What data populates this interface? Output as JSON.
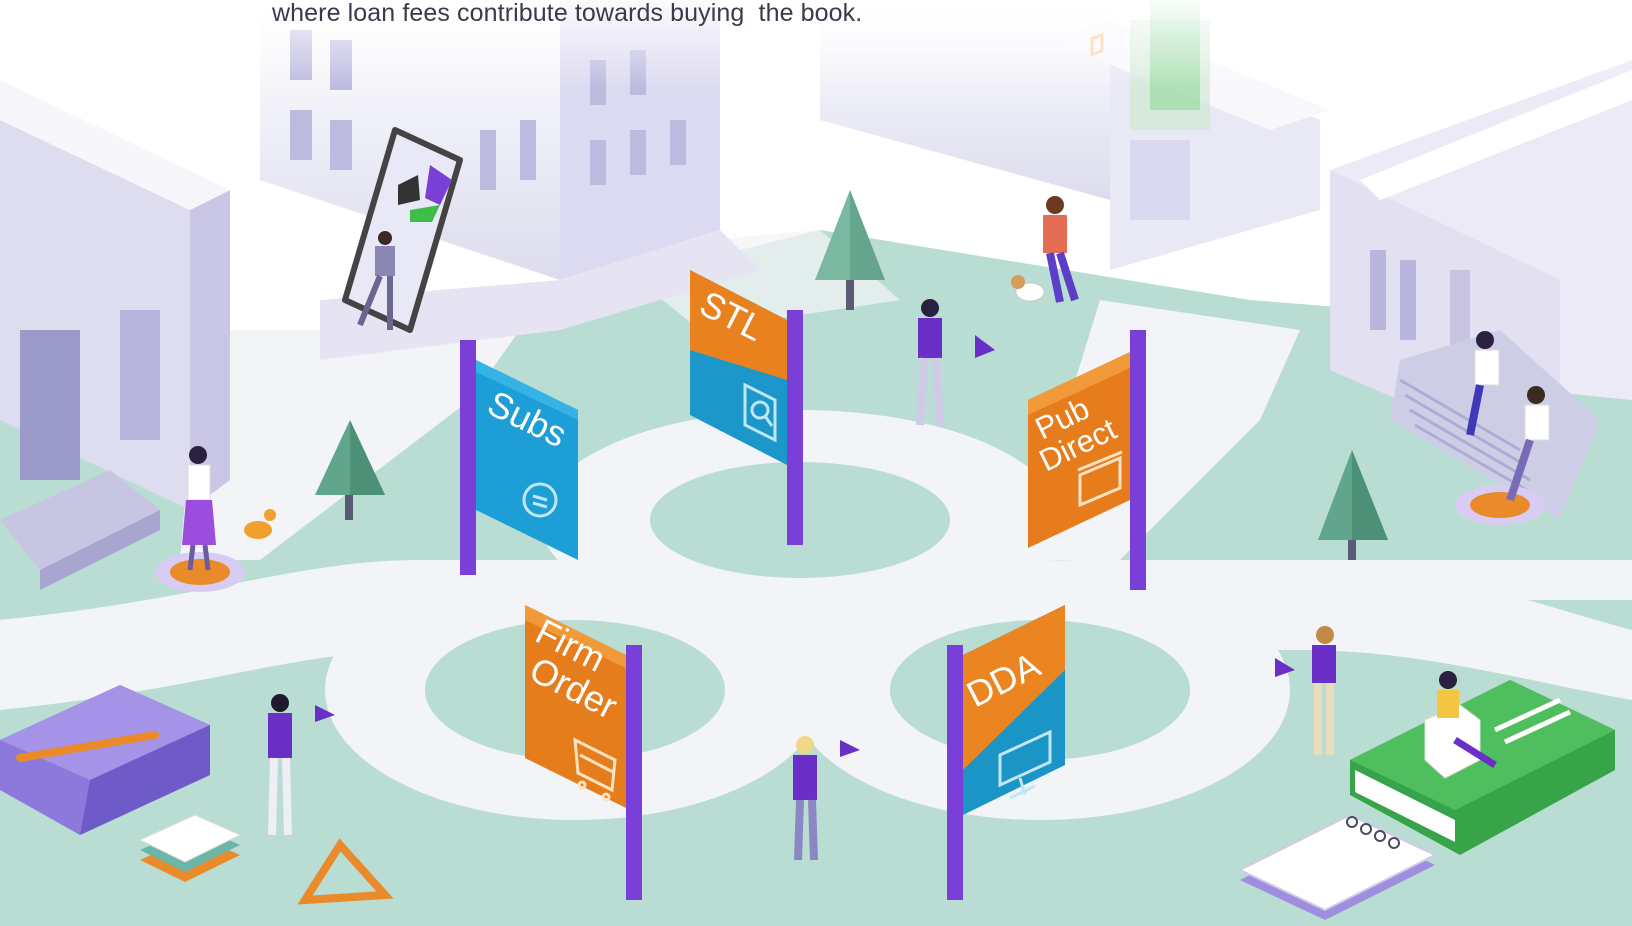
{
  "caption": {
    "text": "where loan fees contribute towards buying  the book."
  },
  "signs": {
    "subs": {
      "label": "Subs",
      "icon": "subscription-refresh-icon",
      "color_top": "#1e9ed6",
      "color_bottom": "#1b84b8"
    },
    "stl": {
      "label": "STL",
      "icon": "search-document-icon",
      "color_top": "#e9811f",
      "color_bottom": "#1b97c9"
    },
    "pub_direct": {
      "line1": "Pub",
      "line2": "Direct",
      "icon": "storefront-icon",
      "color_top": "#ec8b23",
      "color_bottom": "#e67c1b"
    },
    "firm_order": {
      "line1": "Firm",
      "line2": "Order",
      "icon": "shopping-cart-icon",
      "color_top": "#ed8b24",
      "color_bottom": "#e67d1c"
    },
    "dda": {
      "label": "DDA",
      "icon": "computer-monitor-icon",
      "color_top": "#ea8522",
      "color_bottom": "#1b94c6"
    }
  },
  "colors": {
    "ground": "#b9ddd3",
    "path": "#f4f5f8",
    "building": "#e6e6f2",
    "building_shadow": "#c9c8e4",
    "pole": "#7a3fd6",
    "tree": "#5fa68c",
    "book_purple": "#8d79dc",
    "book_green": "#37a44a"
  }
}
